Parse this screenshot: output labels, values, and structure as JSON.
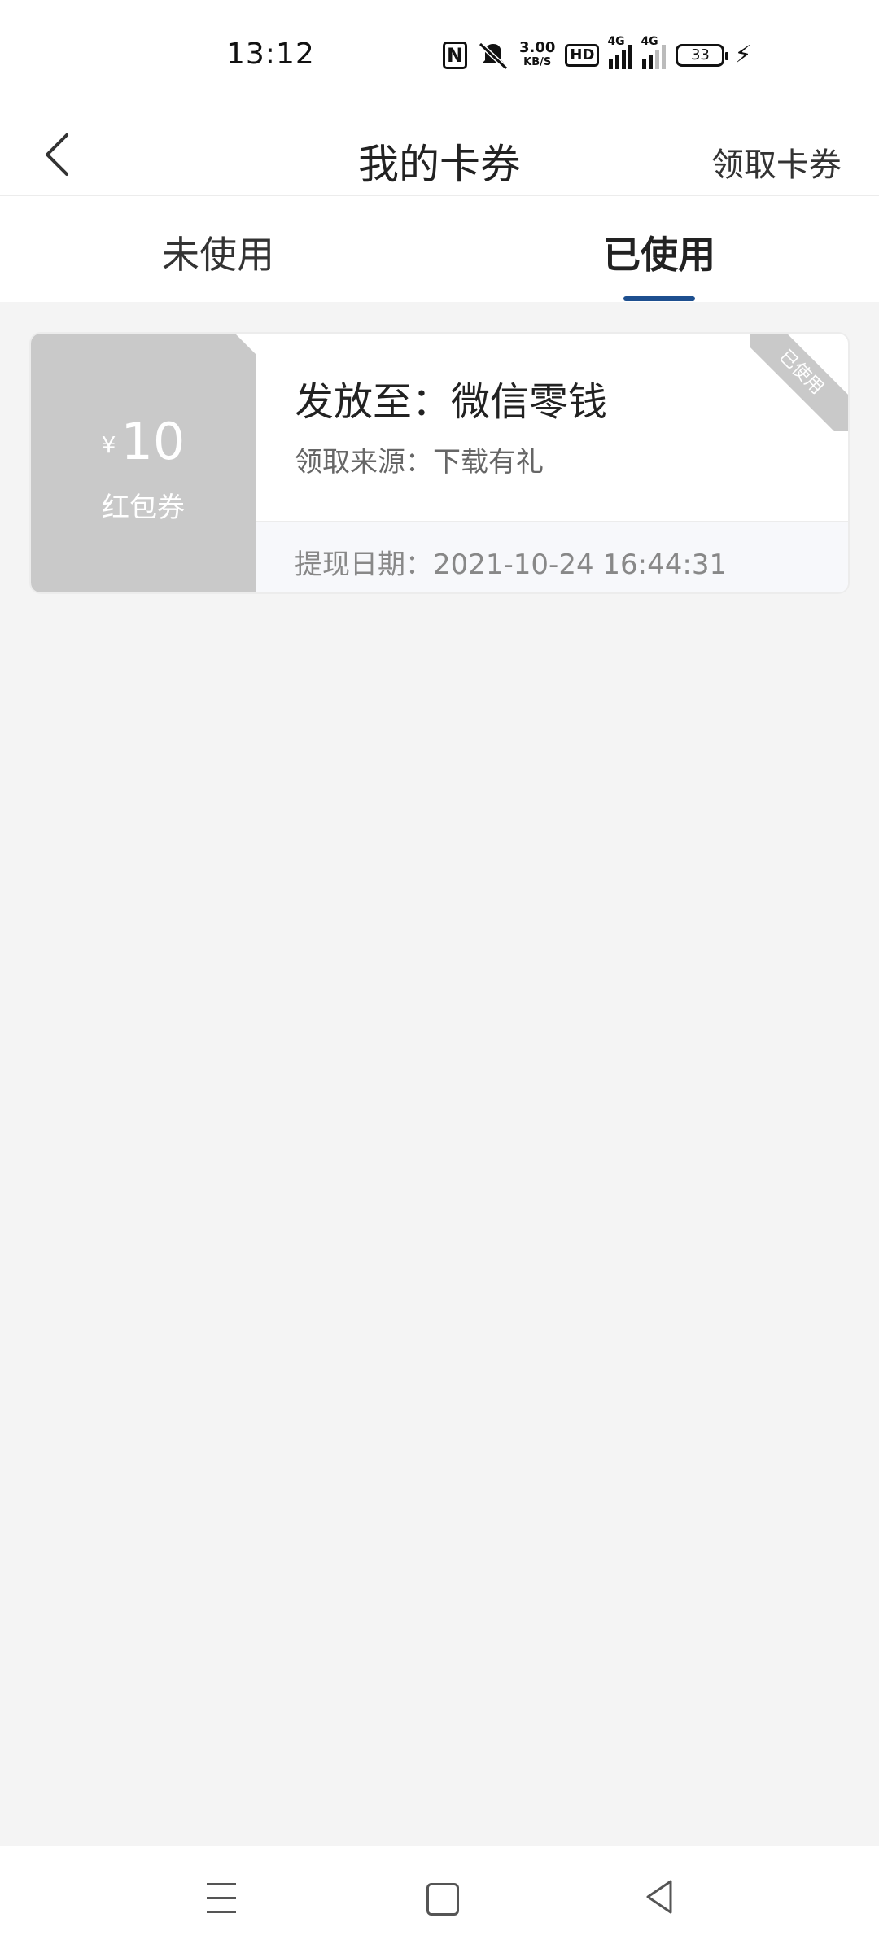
{
  "status_bar": {
    "time": "13:12",
    "speed_value": "3.00",
    "speed_unit": "KB/S",
    "hd_label": "HD",
    "net1": "4G",
    "net2": "4G",
    "battery": "33",
    "icons": [
      "nfc-icon",
      "mute-icon",
      "hd-icon",
      "signal-icon",
      "signal-icon",
      "battery-icon",
      "charging-icon"
    ]
  },
  "nav": {
    "title": "我的卡券",
    "action": "领取卡券"
  },
  "tabs": [
    {
      "label": "未使用",
      "active": false
    },
    {
      "label": "已使用",
      "active": true
    }
  ],
  "coupon": {
    "currency": "¥",
    "amount": "10",
    "type": "红包券",
    "send_to": "发放至：微信零钱",
    "source": "领取来源：下载有礼",
    "cash_date": "提现日期：2021-10-24 16:44:31",
    "status": "已使用"
  },
  "colors": {
    "accent": "#1d4f8f",
    "card_left": "#c9c9c9",
    "page_bg": "#f4f4f4"
  }
}
